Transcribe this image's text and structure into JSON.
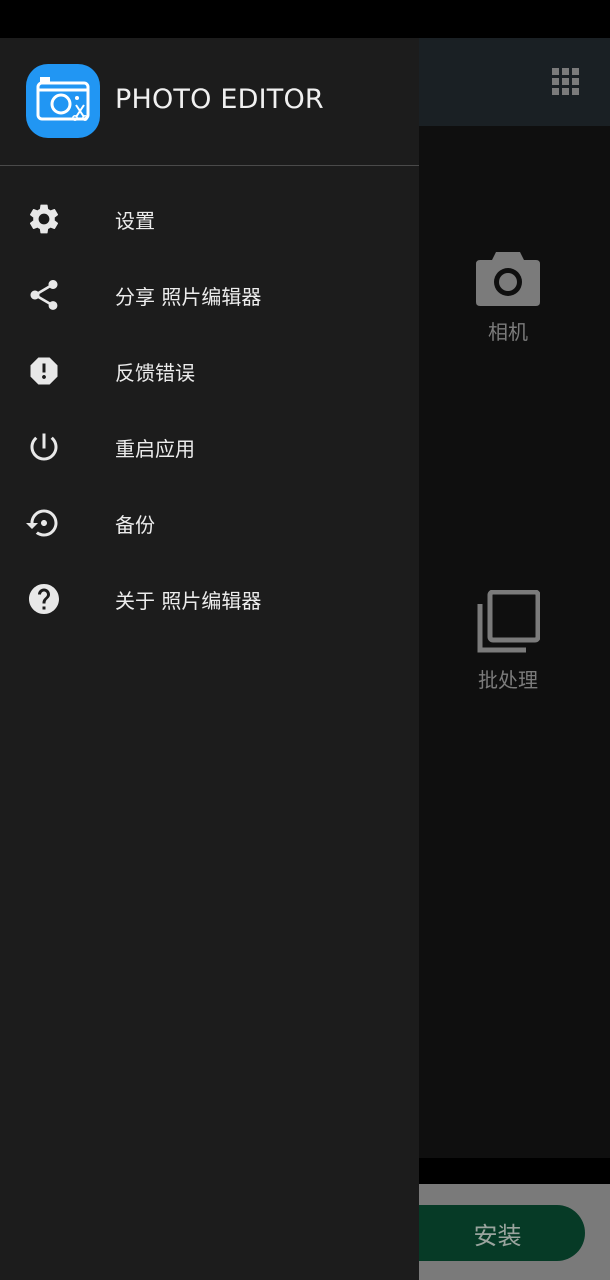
{
  "app": {
    "title": "PHOTO EDITOR"
  },
  "drawer": {
    "items": [
      {
        "label": "设置",
        "icon": "gear-icon"
      },
      {
        "label": "分享 照片编辑器",
        "icon": "share-icon"
      },
      {
        "label": "反馈错误",
        "icon": "report-icon"
      },
      {
        "label": "重启应用",
        "icon": "power-icon"
      },
      {
        "label": "备份",
        "icon": "backup-icon"
      },
      {
        "label": "关于 照片编辑器",
        "icon": "help-icon"
      }
    ]
  },
  "background": {
    "camera_label": "相机",
    "batch_label": "批处理",
    "install_label": "安装"
  },
  "colors": {
    "drawer_bg": "#1c1c1c",
    "logo_blue": "#2196f3",
    "install_btn": "#063a26"
  }
}
